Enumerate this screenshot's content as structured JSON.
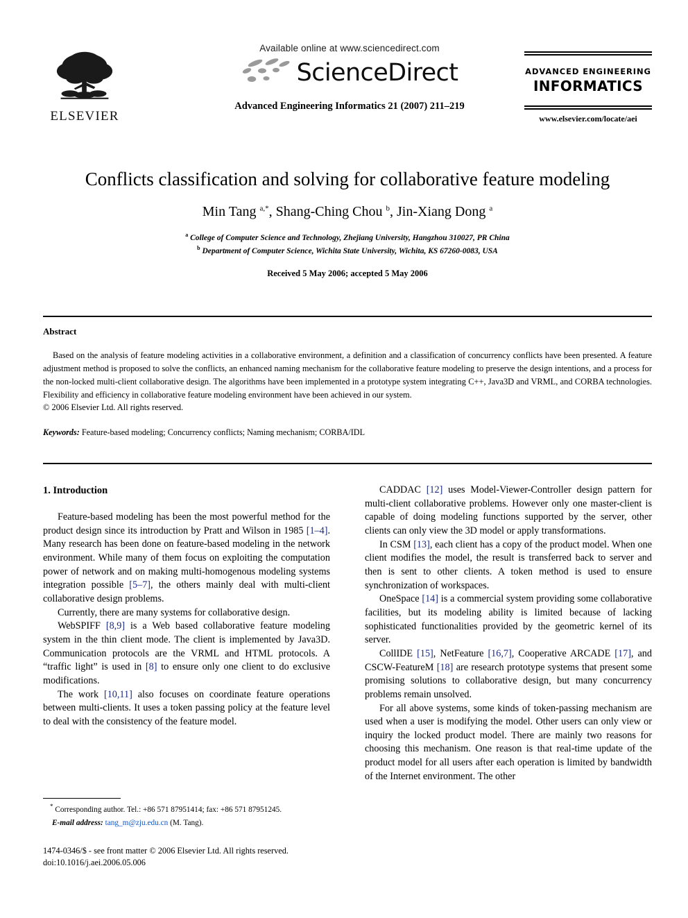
{
  "masthead": {
    "publisher_name": "ELSEVIER",
    "available_online": "Available online at www.sciencedirect.com",
    "sciencedirect_wordmark": "ScienceDirect",
    "journal_citation": "Advanced Engineering Informatics 21 (2007) 211–219",
    "journal_name_line1": "ADVANCED ENGINEERING",
    "journal_name_line2": "INFORMATICS",
    "journal_url": "www.elsevier.com/locate/aei"
  },
  "title_block": {
    "title": "Conflicts classification and solving for collaborative feature modeling",
    "authors": "Min Tang <sup>a,*</sup>, Shang-Ching Chou <sup>b</sup>, Jin-Xiang Dong <sup>a</sup>",
    "affiliation_a": "<sup>a</sup> College of Computer Science and Technology, Zhejiang University, Hangzhou 310027, PR China",
    "affiliation_b": "<sup>b</sup> Department of Computer Science, Wichita State University, Wichita, KS 67260-0083, USA",
    "received": "Received 5 May 2006; accepted 5 May 2006"
  },
  "abstract": {
    "heading": "Abstract",
    "body": "Based on the analysis of feature modeling activities in a collaborative environment, a definition and a classification of concurrency conflicts have been presented. A feature adjustment method is proposed to solve the conflicts, an enhanced naming mechanism for the collaborative feature modeling to preserve the design intentions, and a process for the non-locked multi-client collaborative design. The algorithms have been implemented in a prototype system integrating C++, Java3D and VRML, and CORBA technologies. Flexibility and efficiency in collaborative feature modeling environment have been achieved in our system.",
    "copyright": "© 2006 Elsevier Ltd. All rights reserved.",
    "keywords_label": "Keywords:",
    "keywords_value": "Feature-based modeling; Concurrency conflicts; Naming mechanism; CORBA/IDL"
  },
  "body": {
    "section_heading": "1. Introduction",
    "left_paragraphs": [
      "Feature-based modeling has been the most powerful method for the product design since its introduction by Pratt and Wilson in 1985 <span class=\"cite\">[1–4]</span>. Many research has been done on feature-based modeling in the network environment. While many of them focus on exploiting the computation power of network and on making multi-homogenous modeling systems integration possible <span class=\"cite\">[5–7]</span>, the others mainly deal with multi-client collaborative design problems.",
      "Currently, there are many systems for collaborative design.",
      "WebSPIFF <span class=\"cite\">[8,9]</span> is a Web based collaborative feature modeling system in the thin client mode. The client is implemented by Java3D. Communication protocols are the VRML and HTML protocols. A “traffic light” is used in <span class=\"cite\">[8]</span> to ensure only one client to do exclusive modifications.",
      "The work <span class=\"cite\">[10,11]</span> also focuses on coordinate feature operations between multi-clients. It uses a token passing policy at the feature level to deal with the consistency of the feature model."
    ],
    "right_paragraphs": [
      "CADDAC <span class=\"cite\">[12]</span> uses Model-Viewer-Controller design pattern for multi-client collaborative problems. However only one master-client is capable of doing modeling functions supported by the server, other clients can only view the 3D model or apply transformations.",
      "In CSM <span class=\"cite\">[13]</span>, each client has a copy of the product model. When one client modifies the model, the result is transferred back to server and then is sent to other clients. A token method is used to ensure synchronization of workspaces.",
      "OneSpace <span class=\"cite\">[14]</span> is a commercial system providing some collaborative facilities, but its modeling ability is limited because of lacking sophisticated functionalities provided by the geometric kernel of its server.",
      "CollIDE <span class=\"cite\">[15]</span>, NetFeature <span class=\"cite\">[16,7]</span>, Cooperative ARCADE <span class=\"cite\">[17]</span>, and CSCW-FeatureM <span class=\"cite\">[18]</span> are research prototype systems that present some promising solutions to collaborative design, but many concurrency problems remain unsolved.",
      "For all above systems, some kinds of token-passing mechanism are used when a user is modifying the model. Other users can only view or inquiry the locked product model. There are mainly two reasons for choosing this mechanism. One reason is that real-time update of the product model for all users after each operation is limited by bandwidth of the Internet environment. The other"
    ]
  },
  "footnote": {
    "corresponding": "<sup>*</sup> Corresponding author. Tel.: +86 571 87951414; fax: +86 571 87951245.",
    "email_label": "E-mail address:",
    "email_address": "tang_m@zju.edu.cn",
    "email_suffix": "(M. Tang)."
  },
  "imprint": {
    "line1": "1474-0346/$ - see front matter © 2006 Elsevier Ltd. All rights reserved.",
    "line2": "doi:10.1016/j.aei.2006.05.006"
  },
  "colors": {
    "citation_link": "#1b2a80",
    "email_link": "#1155cc",
    "text": "#000000",
    "page_background": "#ffffff"
  }
}
